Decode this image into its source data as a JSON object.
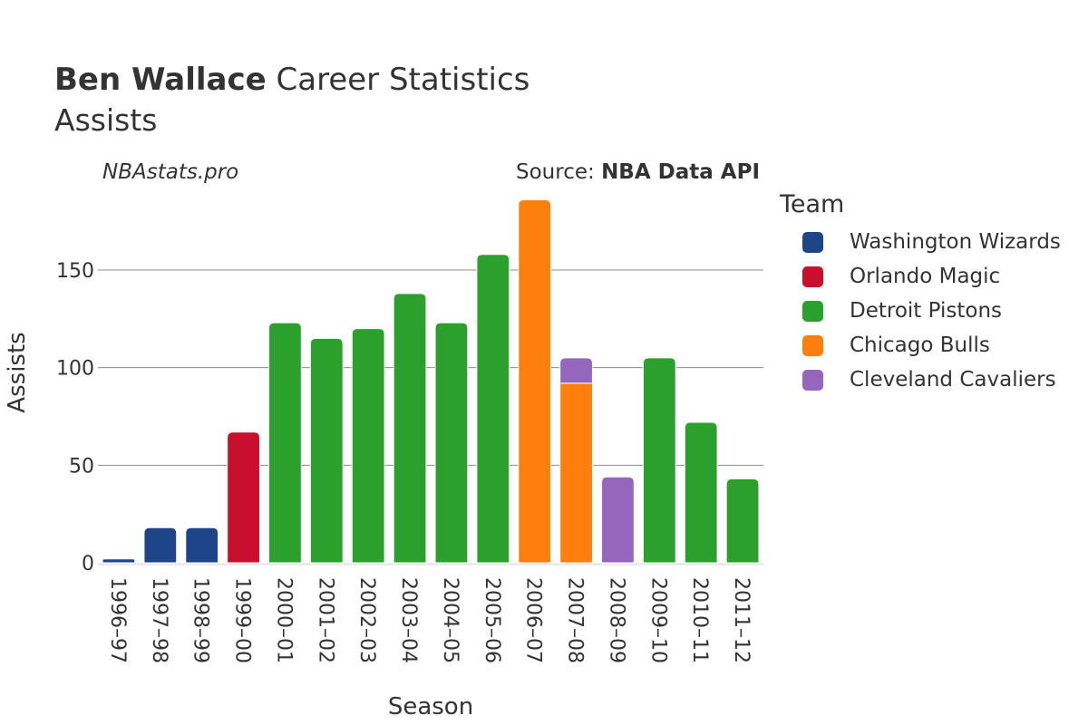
{
  "header": {
    "player_name": "Ben Wallace",
    "title_rest": " Career Statistics",
    "subtitle": "Assists",
    "watermark": "NBAstats.pro",
    "source_prefix": "Source: ",
    "source_name": "NBA Data API"
  },
  "legend": {
    "title": "Team",
    "items": [
      {
        "label": "Washington Wizards",
        "color": "#1f4589"
      },
      {
        "label": "Orlando Magic",
        "color": "#c8102e"
      },
      {
        "label": "Detroit Pistons",
        "color": "#2ca02c"
      },
      {
        "label": "Chicago Bulls",
        "color": "#ff7f0e"
      },
      {
        "label": "Cleveland Cavaliers",
        "color": "#9467bd"
      }
    ]
  },
  "chart_data": {
    "type": "bar",
    "stacked": true,
    "title": "Ben Wallace Career Statistics",
    "subtitle": "Assists",
    "xlabel": "Season",
    "ylabel": "Assists",
    "ylim": [
      0,
      190
    ],
    "yticks": [
      0,
      50,
      100,
      150
    ],
    "grid": true,
    "legend_position": "right",
    "categories": [
      "1996–97",
      "1997–98",
      "1998–99",
      "1999–00",
      "2000–01",
      "2001–02",
      "2002–03",
      "2003–04",
      "2004–05",
      "2005–06",
      "2006–07",
      "2007–08",
      "2008–09",
      "2009–10",
      "2010–11",
      "2011–12"
    ],
    "series": [
      {
        "name": "Washington Wizards",
        "color": "#1f4589",
        "values": [
          2,
          18,
          18,
          0,
          0,
          0,
          0,
          0,
          0,
          0,
          0,
          0,
          0,
          0,
          0,
          0
        ]
      },
      {
        "name": "Orlando Magic",
        "color": "#c8102e",
        "values": [
          0,
          0,
          0,
          67,
          0,
          0,
          0,
          0,
          0,
          0,
          0,
          0,
          0,
          0,
          0,
          0
        ]
      },
      {
        "name": "Detroit Pistons",
        "color": "#2ca02c",
        "values": [
          0,
          0,
          0,
          0,
          123,
          115,
          120,
          138,
          123,
          158,
          0,
          0,
          0,
          105,
          72,
          43
        ]
      },
      {
        "name": "Chicago Bulls",
        "color": "#ff7f0e",
        "values": [
          0,
          0,
          0,
          0,
          0,
          0,
          0,
          0,
          0,
          0,
          186,
          92,
          0,
          0,
          0,
          0
        ]
      },
      {
        "name": "Cleveland Cavaliers",
        "color": "#9467bd",
        "values": [
          0,
          0,
          0,
          0,
          0,
          0,
          0,
          0,
          0,
          0,
          0,
          13,
          44,
          0,
          0,
          0
        ]
      }
    ]
  }
}
